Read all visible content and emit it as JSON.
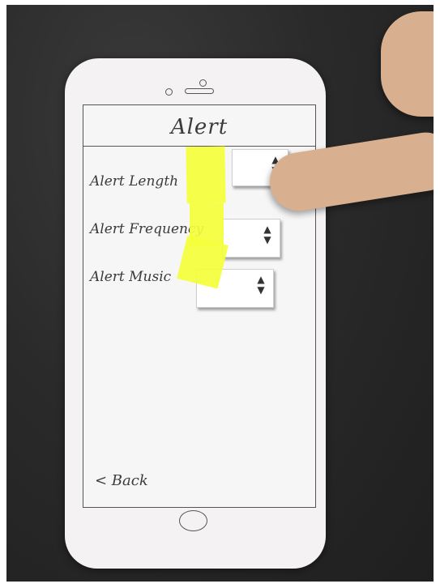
{
  "app": {
    "title": "Alert"
  },
  "settings": [
    {
      "label": "Alert Length"
    },
    {
      "label": "Alert Frequency"
    },
    {
      "label": "Alert Music"
    }
  ],
  "stepper_symbols": {
    "up": "▲",
    "down": "▼"
  },
  "nav": {
    "back_label": "< Back"
  },
  "colors": {
    "background": "#2a2a2a",
    "paper": "#f4f2f3",
    "sticky_note": "#f4ff3a",
    "ink": "#3b3b3b"
  }
}
